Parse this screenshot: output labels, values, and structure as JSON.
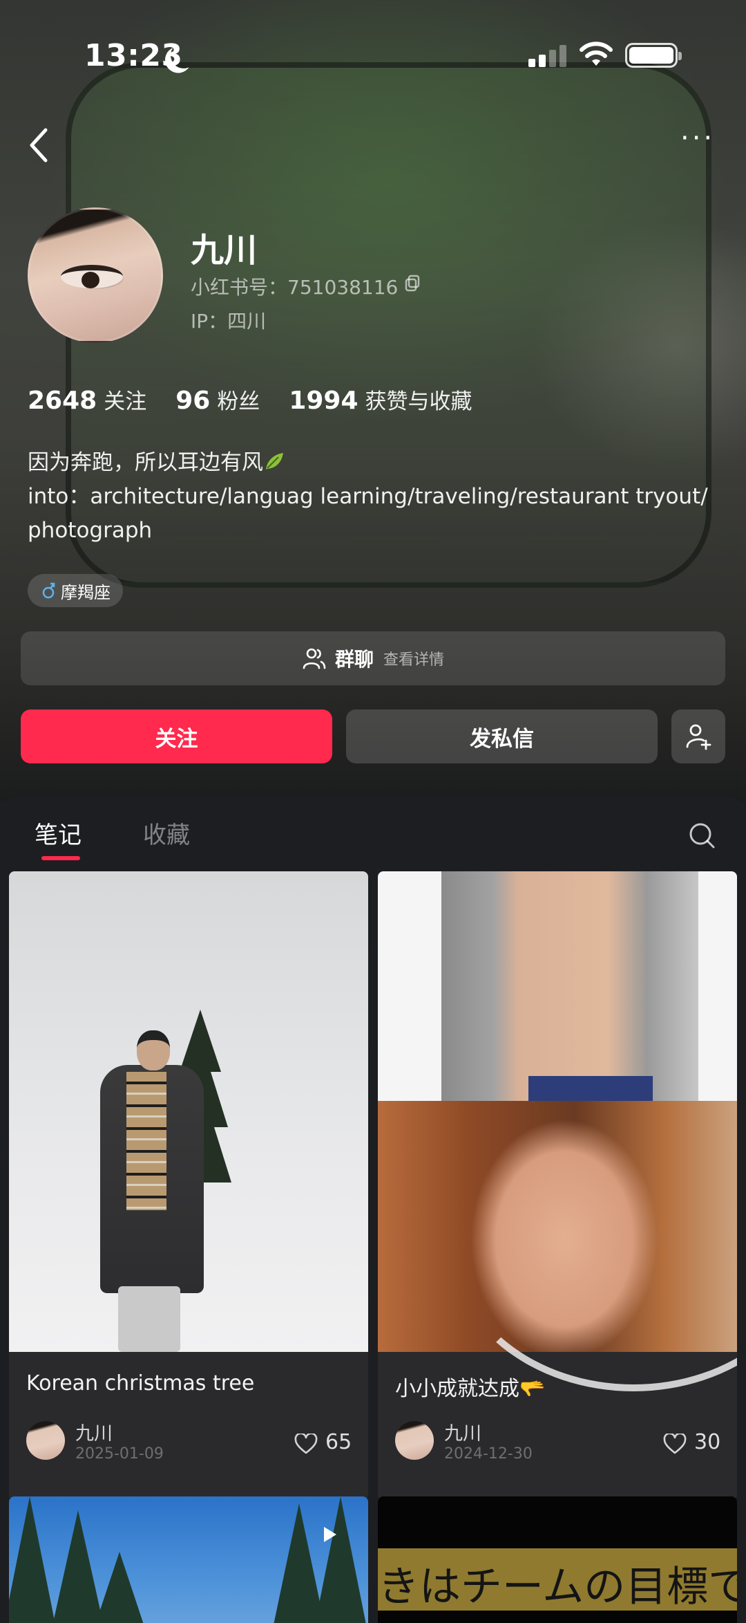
{
  "status_bar": {
    "time": "13:23"
  },
  "profile": {
    "name": "九川",
    "id_text": "小红书号：751038116",
    "ip_text": "IP：四川"
  },
  "stats": [
    {
      "value": "2648",
      "label": "关注"
    },
    {
      "value": "96",
      "label": "粉丝"
    },
    {
      "value": "1994",
      "label": "获赞与收藏"
    }
  ],
  "bio": {
    "line1": "因为奔跑，所以耳边有风",
    "line2": "into：architecture/languag learning/traveling/restaurant tryout/",
    "line3": "photograph"
  },
  "tag": {
    "label": "摩羯座"
  },
  "group_chat": {
    "label": "群聊",
    "detail": "查看详情"
  },
  "actions": {
    "follow": "关注",
    "message": "发私信"
  },
  "tabs": [
    {
      "label": "笔记"
    },
    {
      "label": "收藏"
    }
  ],
  "notes": [
    {
      "title": "Korean christmas tree",
      "author": "九川",
      "date": "2025-01-09",
      "likes": "65"
    },
    {
      "title": "小小成就达成🫳",
      "author": "九川",
      "date": "2024-12-30",
      "likes": "30"
    },
    {
      "overlay_text": ""
    },
    {
      "overlay_text": "きはチームの目標で"
    }
  ],
  "colors": {
    "accent": "#ff2a4d",
    "panel": "#1d1e21",
    "card": "#2a2a2d"
  }
}
